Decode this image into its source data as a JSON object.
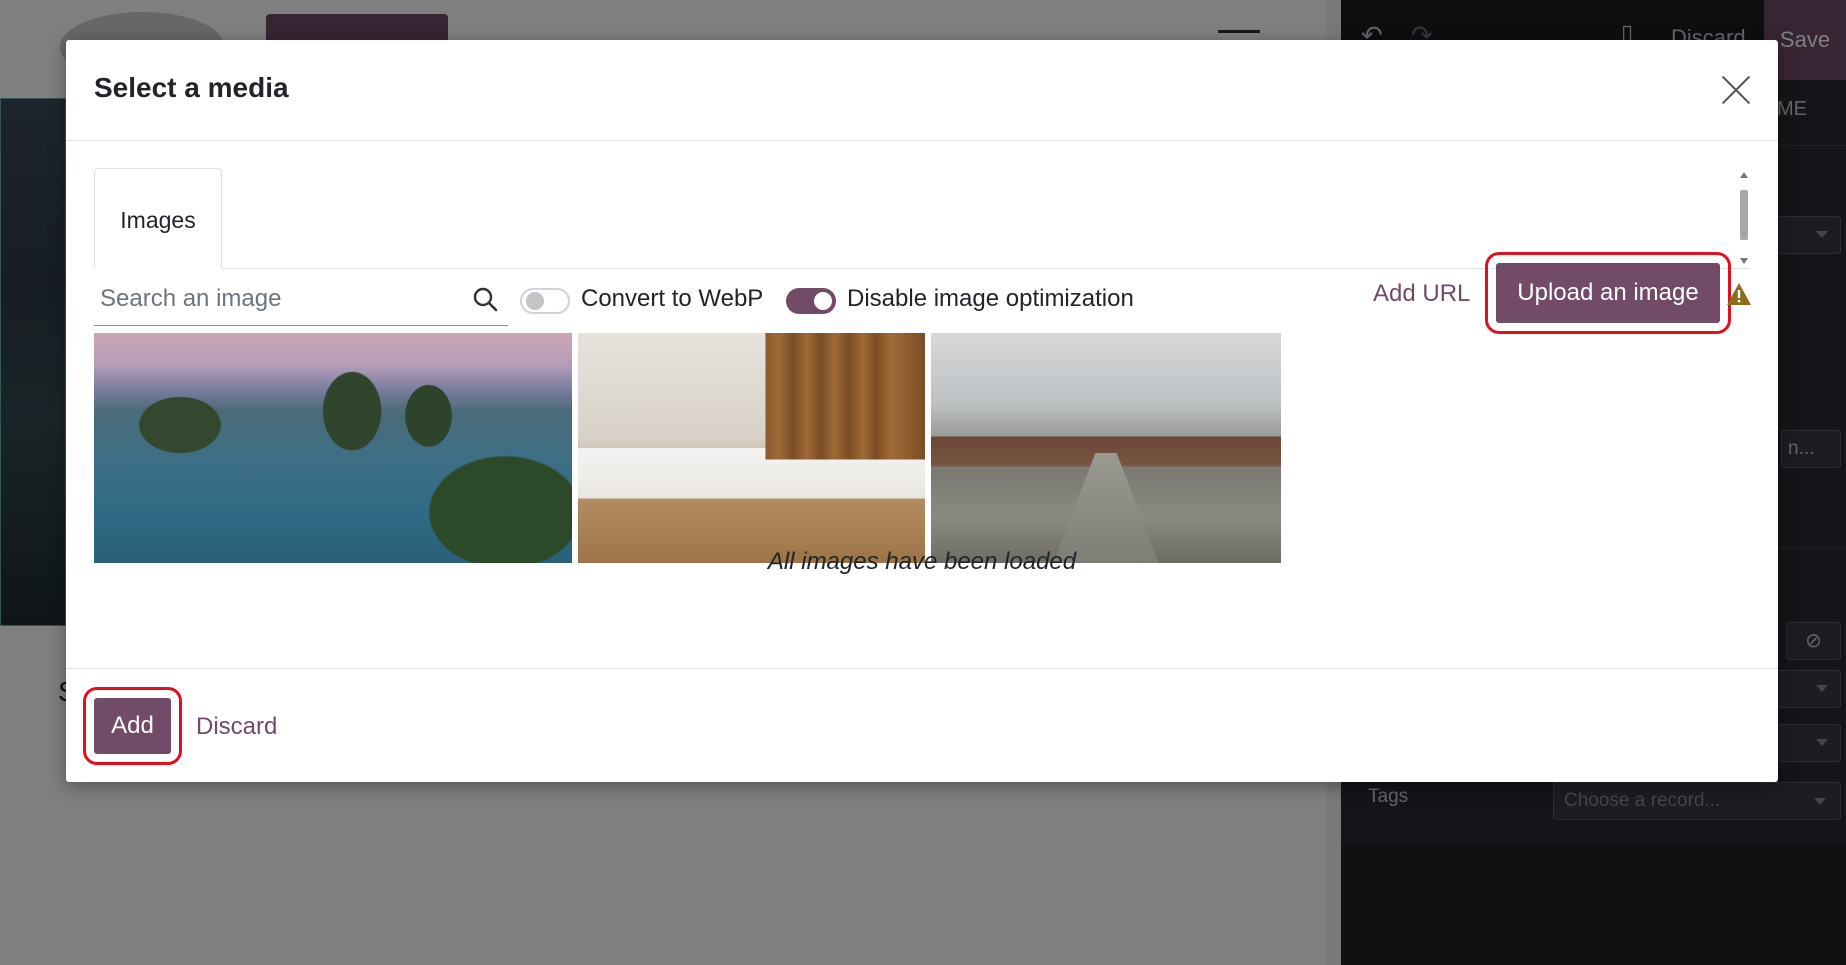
{
  "background_page": {
    "letter": "S"
  },
  "editor_sidebar": {
    "discard_label": "Discard",
    "save_label": "Save",
    "tab_fragment": "ME",
    "field_fragment": "n...",
    "tags_label": "Tags",
    "tags_placeholder": "Choose a record...",
    "ban_icon_glyph": "⊘"
  },
  "modal": {
    "title": "Select a media",
    "tabs": [
      {
        "label": "Images"
      }
    ],
    "search": {
      "placeholder": "Search an image",
      "value": ""
    },
    "toggles": [
      {
        "label": "Convert to WebP",
        "checked": false
      },
      {
        "label": "Disable image optimization",
        "checked": true
      }
    ],
    "add_url_label": "Add URL",
    "upload_label": "Upload an image",
    "images": [
      {
        "description": "Aerial view of a bay with limestone karst islands and boats"
      },
      {
        "description": "Hotel room with two white beds and wooden wall panels"
      },
      {
        "description": "Ancient citadel gate with stone walkway under a cloudy sky"
      }
    ],
    "loaded_message": "All images have been loaded",
    "footer": {
      "add_label": "Add",
      "discard_label": "Discard"
    }
  },
  "colors": {
    "accent": "#714b67",
    "highlight": "#e0101e",
    "warning": "#8a6d1e"
  }
}
